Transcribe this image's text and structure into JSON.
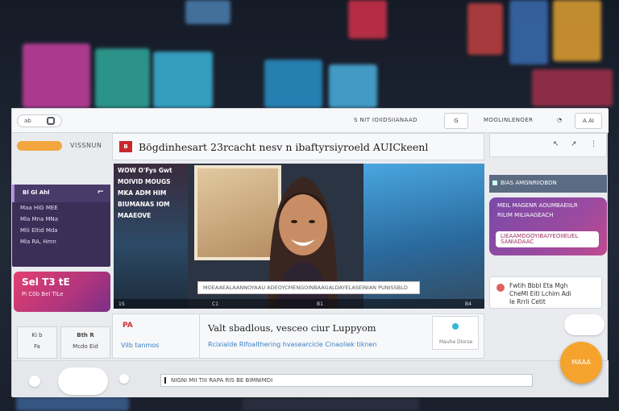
{
  "top_bar": {
    "left_pill": "ab",
    "center_text": "S NIT IOIIDSIIANAAD",
    "center_btn": "G",
    "right_text": "MOOLINLENOER",
    "right_btn": "A AI"
  },
  "left": {
    "label": "VISSNUN",
    "card": {
      "title": "Bl Gl Ahl",
      "lines": [
        "Maa HIG MEE",
        "Mla Mna MNa",
        "Mlii Eltid Mda",
        "Mla RA, Hmn"
      ]
    },
    "promo": {
      "title": "Sel T3 tE",
      "sub": "Pi C0b Bel TiLe"
    },
    "small_card_1": {
      "a": "Ki b",
      "b": "Fa"
    },
    "small_card_2": {
      "a": "Bth R",
      "b": "Mcdo Eid"
    }
  },
  "main": {
    "title": "Bögdinhesart 23rcacht nesv n ibaftyrsiyroeld AUICkeenl",
    "logo": "B",
    "video": {
      "left_text": [
        "WOW O'Fys Gwt",
        "MOIVID MOUGS",
        "MKA ADM HIM",
        "BIUMANAS IOM",
        "MAAEOVE"
      ],
      "caption": "MOEAAEALAANNOYAAU ADEOYCMENGOINBAAGALDAYELASEINIAN PUNISSBLD",
      "controls": [
        "1S",
        "C1",
        "B1",
        "B4"
      ]
    },
    "info": {
      "box_a": "PA",
      "box_b": "Vilb tanmos",
      "headline": "Valt sbadlous, vesceo ciur Luppyom",
      "links": "Rcixialde Rlfoalthering  hvasearcicle Cinaoliek tiknen",
      "box_c": "Mauhe Dlorse"
    }
  },
  "right": {
    "bar_text": "BIAS AMGNRIIOBDN",
    "purple": {
      "lines": [
        "MEIL MAGENR AOUMBAEIILR",
        "RILIM MILIAAGEACH"
      ],
      "inner": [
        "LIEAAMDGOYIBAIYEOIIEUEL",
        "SANIADAAC"
      ]
    },
    "white_card": [
      "Fwtih Bbbl Eta Mgh",
      "CheMI Eitl Lchim Adi",
      "Ie Rrrli Cetit"
    ]
  },
  "bottom": {
    "search": "NIGNI MII TIII RAPA RIS BE  BIMNIMDI"
  },
  "fab_label": "MAAA"
}
